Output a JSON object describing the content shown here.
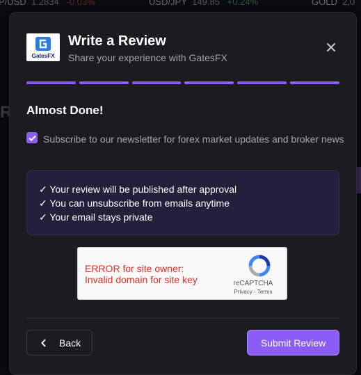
{
  "ticker": [
    {
      "pair": "P/USD",
      "price": "1.2834",
      "change": "-0.03%",
      "direction": "down"
    },
    {
      "pair": "USD/JPY",
      "price": "149.85",
      "change": "+0.24%",
      "direction": "up"
    },
    {
      "pair": "GOLD",
      "price": "2,0",
      "change": "",
      "direction": ""
    }
  ],
  "background": {
    "partial_letter": "R"
  },
  "modal": {
    "logo_text": "GatesFX",
    "title": "Write a Review",
    "subtitle": "Share your experience with GatesFX",
    "close_icon": "close-icon",
    "progress": {
      "steps_total": 6,
      "steps_completed": 6,
      "color": "#8b5cf6"
    },
    "step_title": "Almost Done!",
    "newsletter": {
      "checked": true,
      "label": "Subscribe to our newsletter for forex market updates and broker news"
    },
    "info": [
      "✓ Your review will be published after approval",
      "✓ You can unsubscribe from emails anytime",
      "✓ Your email stays private"
    ],
    "recaptcha": {
      "error_line1": "ERROR for site owner:",
      "error_line2": "Invalid domain for site key",
      "brand": "reCAPTCHA",
      "links": "Privacy - Terms"
    },
    "buttons": {
      "back": "Back",
      "submit": "Submit Review"
    }
  },
  "colors": {
    "accent": "#8b5cf6",
    "modal_bg": "#1c1c20",
    "error": "#d93025"
  }
}
